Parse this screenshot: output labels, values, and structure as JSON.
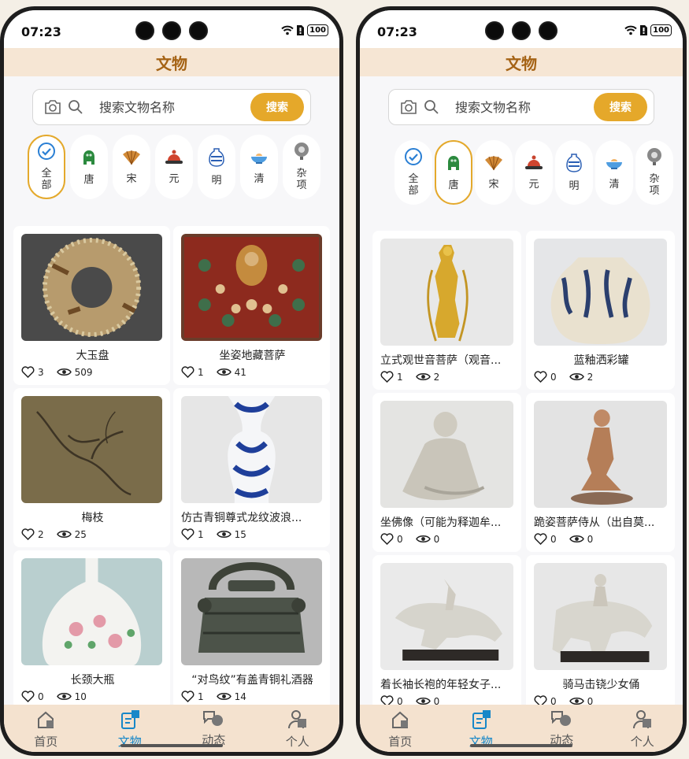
{
  "left": {
    "status": {
      "time": "07:23",
      "battery": "100"
    },
    "title": "文物",
    "search": {
      "placeholder": "搜索文物名称",
      "button": "搜索"
    },
    "categories": [
      {
        "label": "全部",
        "icon": "check-circle-icon",
        "active": true
      },
      {
        "label": "唐",
        "icon": "tang-lion-icon",
        "active": false
      },
      {
        "label": "宋",
        "icon": "song-fan-icon",
        "active": false
      },
      {
        "label": "元",
        "icon": "yuan-hat-icon",
        "active": false
      },
      {
        "label": "明",
        "icon": "ming-vase-icon",
        "active": false
      },
      {
        "label": "清",
        "icon": "qing-bowl-icon",
        "active": false
      },
      {
        "label": "杂项",
        "icon": "misc-mirror-icon",
        "active": false
      }
    ],
    "items": [
      {
        "name": "大玉盘",
        "likes": "3",
        "views": "509"
      },
      {
        "name": "坐姿地藏菩萨",
        "likes": "1",
        "views": "41"
      },
      {
        "name": "梅枝",
        "likes": "2",
        "views": "25"
      },
      {
        "name": "仿古青铜尊式龙纹波浪...",
        "likes": "1",
        "views": "15"
      },
      {
        "name": "长颈大瓶",
        "likes": "0",
        "views": "10"
      },
      {
        "name": "“对鸟纹”有盖青铜礼酒器",
        "likes": "1",
        "views": "14"
      }
    ],
    "tabs": [
      {
        "label": "首页",
        "icon": "home-icon",
        "active": false
      },
      {
        "label": "文物",
        "icon": "artifacts-icon",
        "active": true
      },
      {
        "label": "动态",
        "icon": "feed-icon",
        "active": false
      },
      {
        "label": "个人",
        "icon": "person-icon",
        "active": false
      }
    ]
  },
  "right": {
    "status": {
      "time": "07:23",
      "battery": "100"
    },
    "title": "文物",
    "search": {
      "placeholder": "搜索文物名称",
      "button": "搜索"
    },
    "categories": [
      {
        "label": "全部",
        "icon": "check-circle-icon",
        "active": false
      },
      {
        "label": "唐",
        "icon": "tang-lion-icon",
        "active": true
      },
      {
        "label": "宋",
        "icon": "song-fan-icon",
        "active": false
      },
      {
        "label": "元",
        "icon": "yuan-hat-icon",
        "active": false
      },
      {
        "label": "明",
        "icon": "ming-vase-icon",
        "active": false
      },
      {
        "label": "清",
        "icon": "qing-bowl-icon",
        "active": false
      },
      {
        "label": "杂项",
        "icon": "misc-mirror-icon",
        "active": false
      }
    ],
    "items": [
      {
        "name": "立式观世音菩萨（观音...",
        "likes": "1",
        "views": "2"
      },
      {
        "name": "蓝釉洒彩罐",
        "likes": "0",
        "views": "2"
      },
      {
        "name": "坐佛像（可能为释迦牟...",
        "likes": "0",
        "views": "0"
      },
      {
        "name": "跪姿菩萨侍从（出自莫...",
        "likes": "0",
        "views": "0"
      },
      {
        "name": "着长袖长袍的年轻女子...",
        "likes": "0",
        "views": "0"
      },
      {
        "name": "骑马击铙少女俑",
        "likes": "0",
        "views": "0"
      }
    ],
    "tabs": [
      {
        "label": "首页",
        "icon": "home-icon",
        "active": false
      },
      {
        "label": "文物",
        "icon": "artifacts-icon",
        "active": true
      },
      {
        "label": "动态",
        "icon": "feed-icon",
        "active": false
      },
      {
        "label": "个人",
        "icon": "person-icon",
        "active": false
      }
    ]
  },
  "colors": {
    "accent": "#e5a82a",
    "title": "#a56315",
    "tab_active": "#1787c8",
    "header_bg": "#f6e6d4"
  }
}
